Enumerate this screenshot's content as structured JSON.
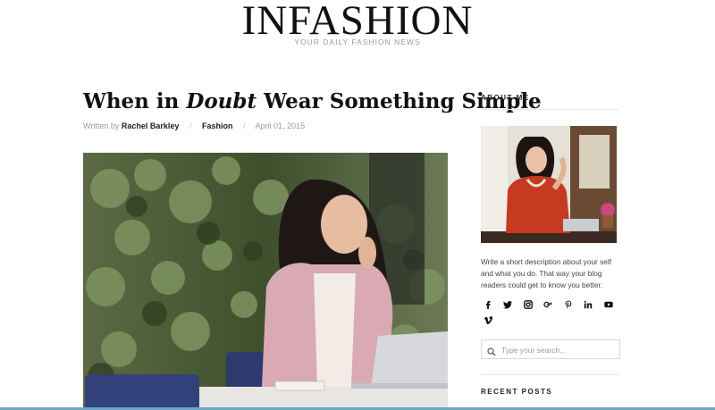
{
  "header": {
    "site_title": "INFASHION",
    "tagline": "YOUR DAILY FASHION NEWS"
  },
  "post": {
    "title_before": "When in ",
    "title_emphasis": "Doubt",
    "title_after": " Wear Something Simple",
    "written_by_label": "Written by",
    "author": "Rachel Barkley",
    "separator": "/",
    "category": "Fashion",
    "date": "April 01, 2015"
  },
  "sidebar": {
    "about_heading": "ABOUT ME",
    "about_text": "Write a short description about your self and what you do. That way your blog readers could get to know you better.",
    "social_icons": [
      "facebook-icon",
      "twitter-icon",
      "instagram-icon",
      "google-plus-icon",
      "pinterest-icon",
      "linkedin-icon",
      "youtube-icon",
      "vimeo-icon"
    ],
    "search_placeholder": "Type your search...",
    "recent_heading": "RECENT POSTS"
  },
  "colors": {
    "accent_line": "#6aa9c8",
    "text_dark": "#111111",
    "text_muted": "#999999"
  }
}
